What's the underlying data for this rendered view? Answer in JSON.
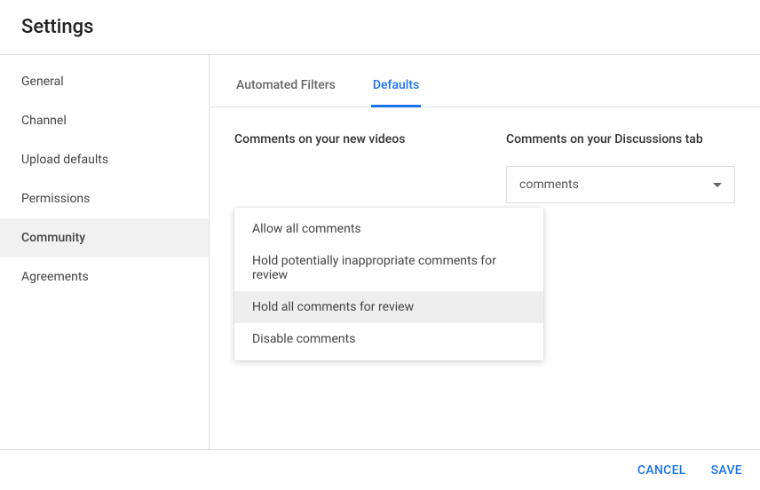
{
  "page_title": "Settings",
  "sidebar": {
    "items": [
      {
        "label": "General",
        "active": false
      },
      {
        "label": "Channel",
        "active": false
      },
      {
        "label": "Upload defaults",
        "active": false
      },
      {
        "label": "Permissions",
        "active": false
      },
      {
        "label": "Community",
        "active": true
      },
      {
        "label": "Agreements",
        "active": false
      }
    ]
  },
  "tabs": [
    {
      "label": "Automated Filters",
      "active": false
    },
    {
      "label": "Defaults",
      "active": true
    }
  ],
  "fields": {
    "new_videos": {
      "label": "Comments on your new videos"
    },
    "discussions": {
      "label": "Comments on your Discussions tab",
      "selected_visible": "comments"
    }
  },
  "dropdown": {
    "open_for": "new_videos",
    "options": [
      {
        "label": "Allow all comments",
        "highlight": false
      },
      {
        "label": "Hold potentially inappropriate comments for review",
        "highlight": false
      },
      {
        "label": "Hold all comments for review",
        "highlight": true
      },
      {
        "label": "Disable comments",
        "highlight": false
      }
    ]
  },
  "footer": {
    "cancel": "CANCEL",
    "save": "SAVE"
  }
}
